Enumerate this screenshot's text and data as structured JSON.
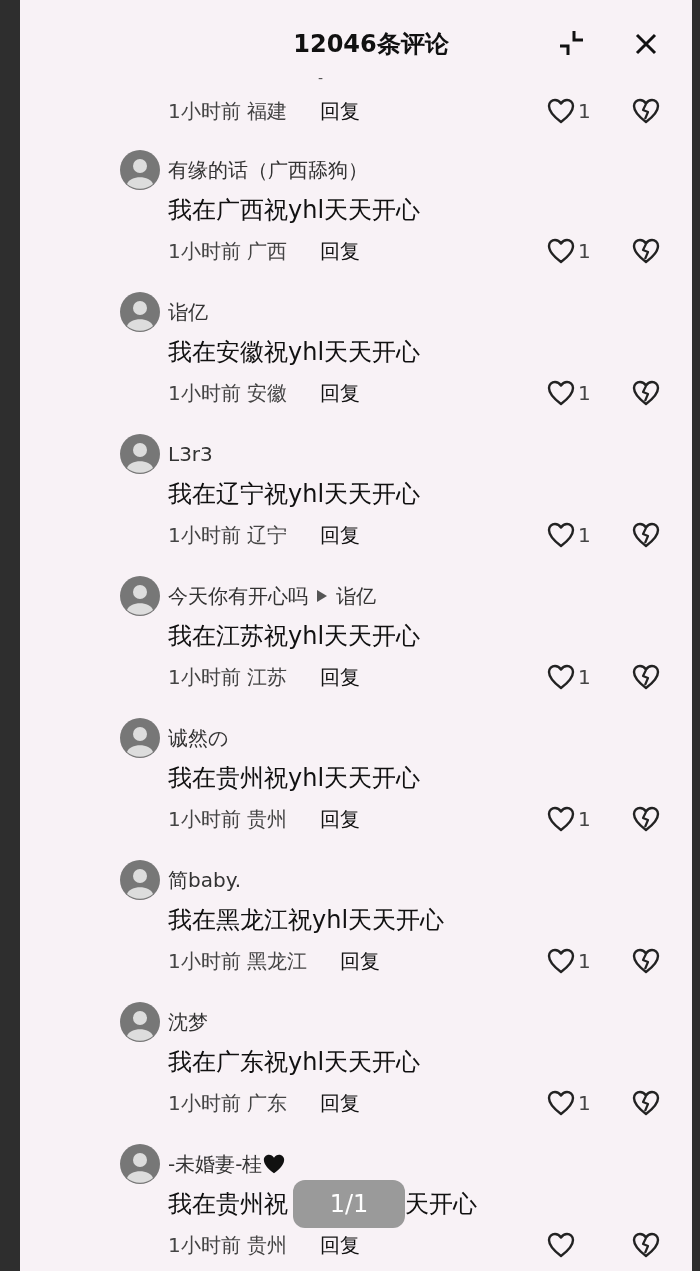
{
  "header": {
    "title": "12046条评论"
  },
  "partial_comment": {
    "text": "-",
    "time": "1小时前",
    "location": "福建",
    "reply": "回复",
    "likes": "1"
  },
  "comments": [
    {
      "name": "有缘的话（广西舔狗）",
      "text": "我在广西祝yhl天天开心",
      "time": "1小时前",
      "location": "广西",
      "reply": "回复",
      "likes": "1"
    },
    {
      "name": "诣亿",
      "text": "我在安徽祝yhl天天开心",
      "time": "1小时前",
      "location": "安徽",
      "reply": "回复",
      "likes": "1"
    },
    {
      "name": "L3r3",
      "text": "我在辽宁祝yhl天天开心",
      "time": "1小时前",
      "location": "辽宁",
      "reply": "回复",
      "likes": "1"
    },
    {
      "name": "今天你有开心吗",
      "reply_to": "诣亿",
      "text": "我在江苏祝yhl天天开心",
      "time": "1小时前",
      "location": "江苏",
      "reply": "回复",
      "likes": "1"
    },
    {
      "name": "诚然の",
      "text": "我在贵州祝yhl天天开心",
      "time": "1小时前",
      "location": "贵州",
      "reply": "回复",
      "likes": "1"
    },
    {
      "name": "简baby.",
      "text": "我在黑龙江祝yhl天天开心",
      "time": "1小时前",
      "location": "黑龙江",
      "reply": "回复",
      "likes": "1"
    },
    {
      "name": "沈梦",
      "text": "我在广东祝yhl天天开心",
      "time": "1小时前",
      "location": "广东",
      "reply": "回复",
      "likes": "1"
    },
    {
      "name": "-未婚妻-桂",
      "name_heart": true,
      "text": "我在贵州祝",
      "text_after_overlay": "天开心",
      "time": "1小时前",
      "location": "贵州",
      "reply": "回复"
    }
  ],
  "page_indicator": "1/1"
}
